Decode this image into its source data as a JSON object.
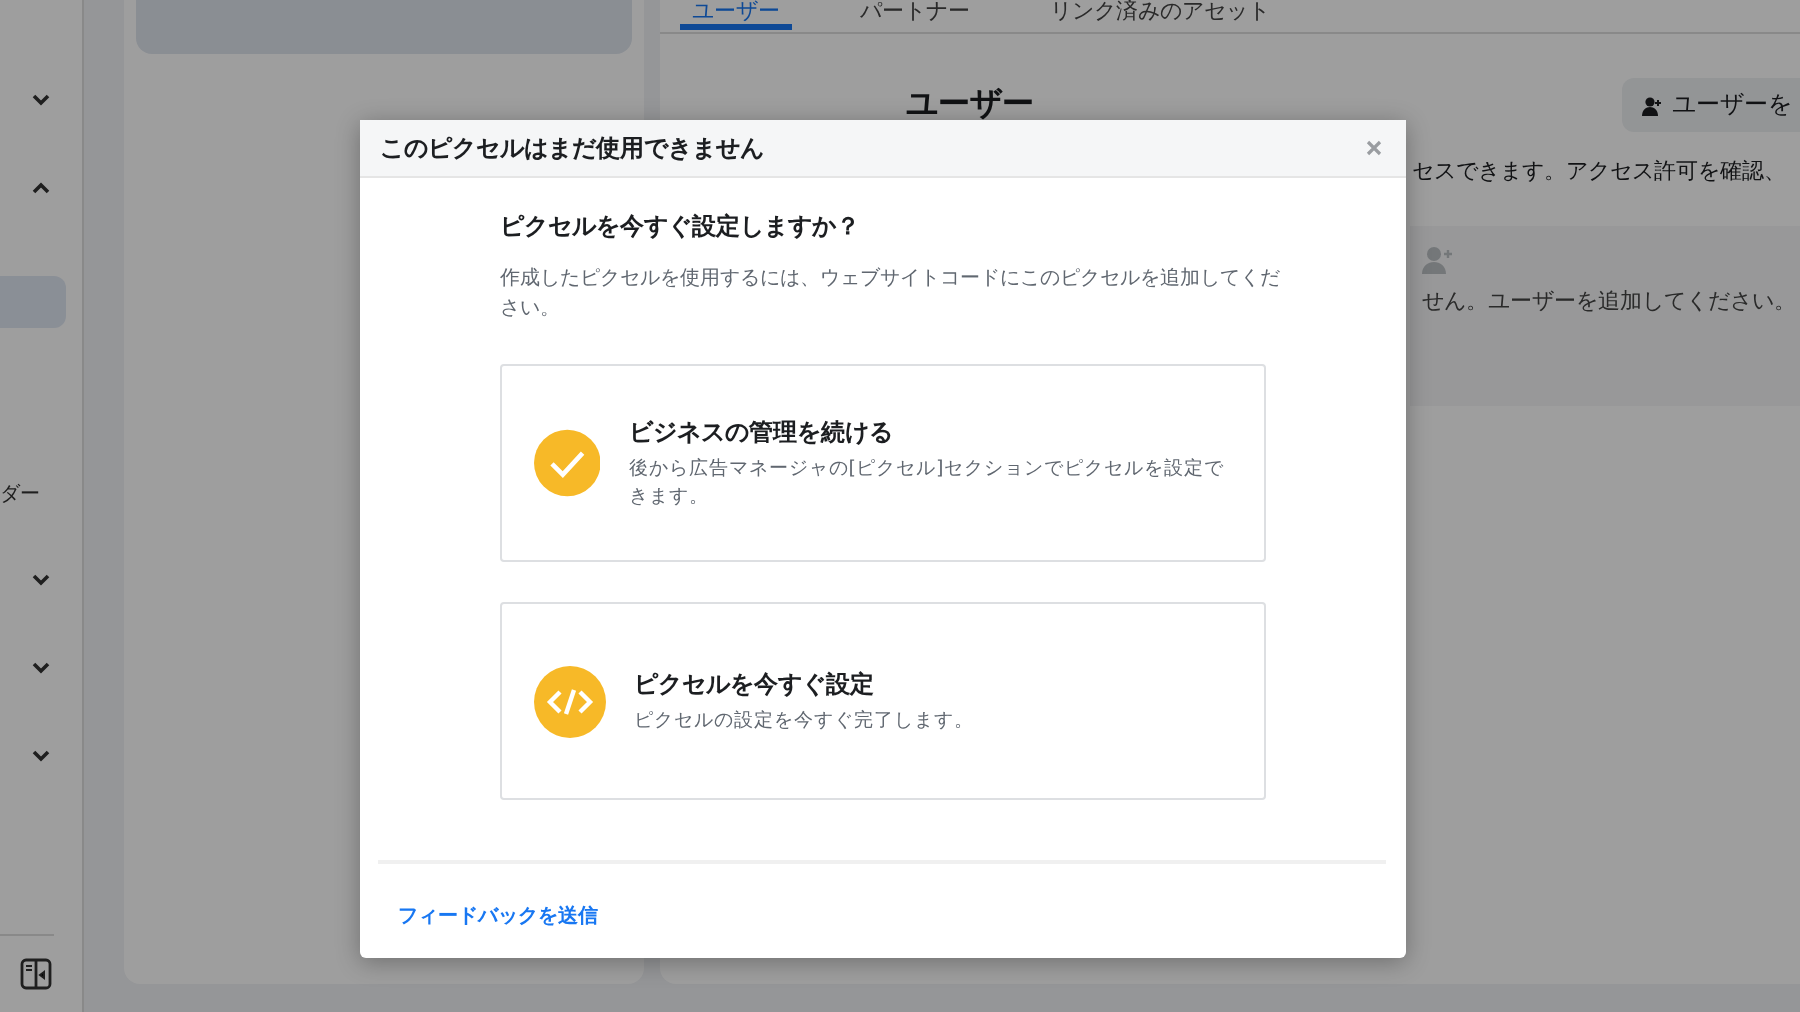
{
  "sidebar": {
    "items": [
      {
        "kind": "chevron",
        "expanded": false
      },
      {
        "kind": "chevron",
        "expanded": true
      },
      {
        "kind": "highlight",
        "selected": true
      },
      {
        "kind": "label",
        "text": "ダー"
      },
      {
        "kind": "chevron",
        "expanded": false
      },
      {
        "kind": "chevron",
        "expanded": false
      },
      {
        "kind": "chevron",
        "expanded": false
      }
    ]
  },
  "main": {
    "tabs": [
      {
        "label": "ユーザー",
        "selected": true
      },
      {
        "label": "パートナー",
        "selected": false
      },
      {
        "label": "リンク済みのアセット",
        "selected": false
      }
    ],
    "heading": "ユーザー",
    "add_button": "ユーザーを",
    "description": "セスできます。アクセス許可を確認、",
    "empty_state": "せん。ユーザーを追加してください。"
  },
  "dialog": {
    "title": "このピクセルはまだ使用できません",
    "heading": "ピクセルを今すぐ設定しますか？",
    "description": "作成したピクセルを使用するには、ウェブサイトコードにこのピクセルを追加してください。",
    "options": [
      {
        "kind": "check",
        "title": "ビジネスの管理を続ける",
        "description": "後から広告マネージャの[ピクセル]セクションでピクセルを設定できます。"
      },
      {
        "kind": "code",
        "title": "ピクセルを今すぐ設定",
        "description": "ピクセルの設定を今すぐ完了します。"
      }
    ],
    "feedback_link": "フィードバックを送信"
  }
}
